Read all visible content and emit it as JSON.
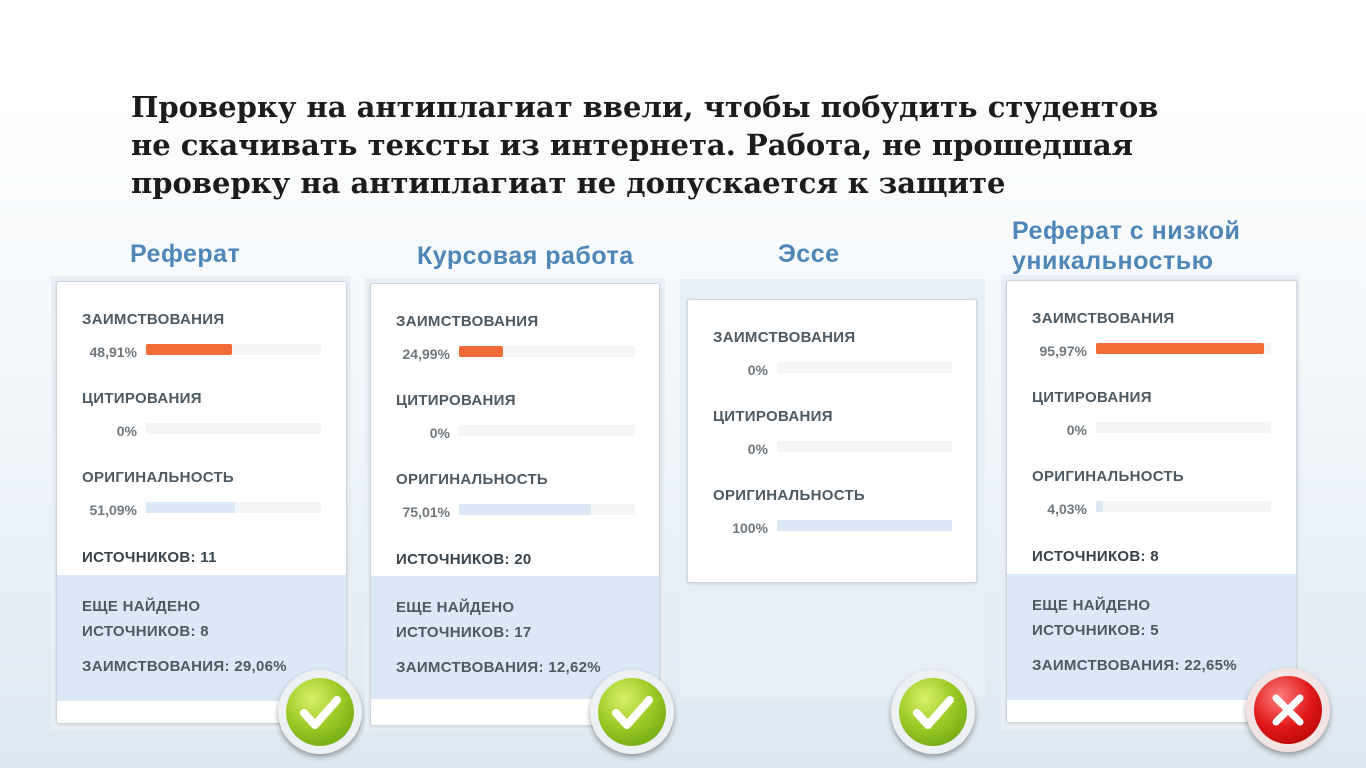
{
  "heading": {
    "lines": [
      "Проверку на антиплагиат ввели, чтобы побудить студентов",
      "не скачивать тексты из интернета. Работа, не прошедшая",
      "проверку на антиплагиат не допускается к защите"
    ]
  },
  "cards": [
    {
      "title": [
        "Реферат"
      ],
      "borrowing_label": "ЗАИМСТВОВАНИЯ",
      "borrowing_value": "48,91%",
      "borrowing_percent": 48.91,
      "citation_label": "ЦИТИРОВАНИЯ",
      "citation_value": "0%",
      "citation_percent": 0,
      "originality_label": "ОРИГИНАЛЬНОСТЬ",
      "originality_value": "51,09%",
      "originality_percent": 51.09,
      "sources": "ИСТОЧНИКОВ:  11",
      "extra_found": "ЕЩЕ НАЙДЕНО",
      "extra_sources": "ИСТОЧНИКОВ:  8",
      "extra_borrowing": "ЗАИМСТВОВАНИЯ:  29,06%",
      "status": "accepted",
      "status_icon": "checkmark-icon"
    },
    {
      "title": [
        "Курсовая работа"
      ],
      "borrowing_label": "ЗАИМСТВОВАНИЯ",
      "borrowing_value": "24,99%",
      "borrowing_percent": 24.99,
      "citation_label": "ЦИТИРОВАНИЯ",
      "citation_value": "0%",
      "citation_percent": 0,
      "originality_label": "ОРИГИНАЛЬНОСТЬ",
      "originality_value": "75,01%",
      "originality_percent": 75.01,
      "sources": "ИСТОЧНИКОВ:  20",
      "extra_found": "ЕЩЕ НАЙДЕНО",
      "extra_sources": "ИСТОЧНИКОВ:  17",
      "extra_borrowing": "ЗАИМСТВОВАНИЯ:  12,62%",
      "status": "accepted",
      "status_icon": "checkmark-icon"
    },
    {
      "title": [
        "Эссе"
      ],
      "borrowing_label": "ЗАИМСТВОВАНИЯ",
      "borrowing_value": "0%",
      "borrowing_percent": 0,
      "citation_label": "ЦИТИРОВАНИЯ",
      "citation_value": "0%",
      "citation_percent": 0,
      "originality_label": "ОРИГИНАЛЬНОСТЬ",
      "originality_value": "100%",
      "originality_percent": 100,
      "status": "accepted",
      "status_icon": "checkmark-icon"
    },
    {
      "title": [
        "Реферат с низкой",
        "уникальностью"
      ],
      "borrowing_label": "ЗАИМСТВОВАНИЯ",
      "borrowing_value": "95,97%",
      "borrowing_percent": 95.97,
      "citation_label": "ЦИТИРОВАНИЯ",
      "citation_value": "0%",
      "citation_percent": 0,
      "originality_label": "ОРИГИНАЛЬНОСТЬ",
      "originality_value": "4,03%",
      "originality_percent": 4.03,
      "sources": "ИСТОЧНИКОВ:  8",
      "extra_found": "ЕЩЕ НАЙДЕНО",
      "extra_sources": "ИСТОЧНИКОВ:  5",
      "extra_borrowing": "ЗАИМСТВОВАНИЯ:  22,65%",
      "status": "rejected",
      "status_icon": "cross-icon"
    }
  ],
  "colors": {
    "borrowing_bar": "#f06b36",
    "originality_bar": "#dbe9f6",
    "title": "#4f86b8",
    "accepted_badge": "#8cc21d",
    "rejected_badge": "#e01717"
  }
}
